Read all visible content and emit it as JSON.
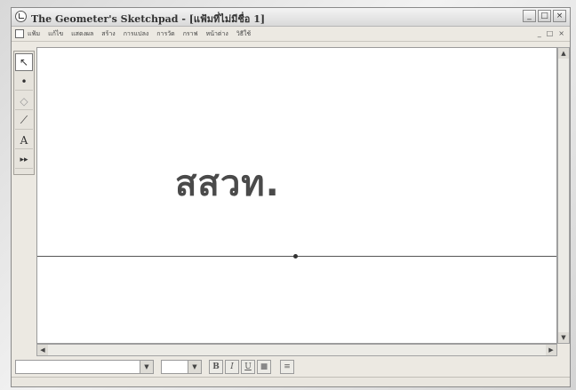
{
  "window": {
    "title": "The Geometer's Sketchpad - [แฟ้มที่ไม่มีชื่อ 1]",
    "buttons": [
      "_",
      "□",
      "×"
    ]
  },
  "menu": {
    "items": [
      "แฟ้ม",
      "แก้ไข",
      "แสดงผล",
      "สร้าง",
      "การแปลง",
      "การวัด",
      "กราฟ",
      "หน้าต่าง",
      "วิธีใช้"
    ],
    "mdi_buttons": [
      "_",
      "□",
      "×"
    ]
  },
  "toolbox": {
    "tools": [
      {
        "name": "arrow-tool",
        "glyph": "↖"
      },
      {
        "name": "point-tool",
        "glyph": "•"
      },
      {
        "name": "compass-tool",
        "glyph": "◇"
      },
      {
        "name": "straightedge-tool",
        "glyph": "⟋"
      },
      {
        "name": "text-tool",
        "glyph": "A"
      },
      {
        "name": "custom-tool",
        "glyph": "▸▸"
      }
    ]
  },
  "canvas": {
    "text": "สสวท."
  },
  "text_toolbar": {
    "font_value": "",
    "size_value": "",
    "bold_label": "B",
    "italic_label": "I",
    "underline_label": "U",
    "color_label": "■",
    "symbol_label": "≡"
  }
}
